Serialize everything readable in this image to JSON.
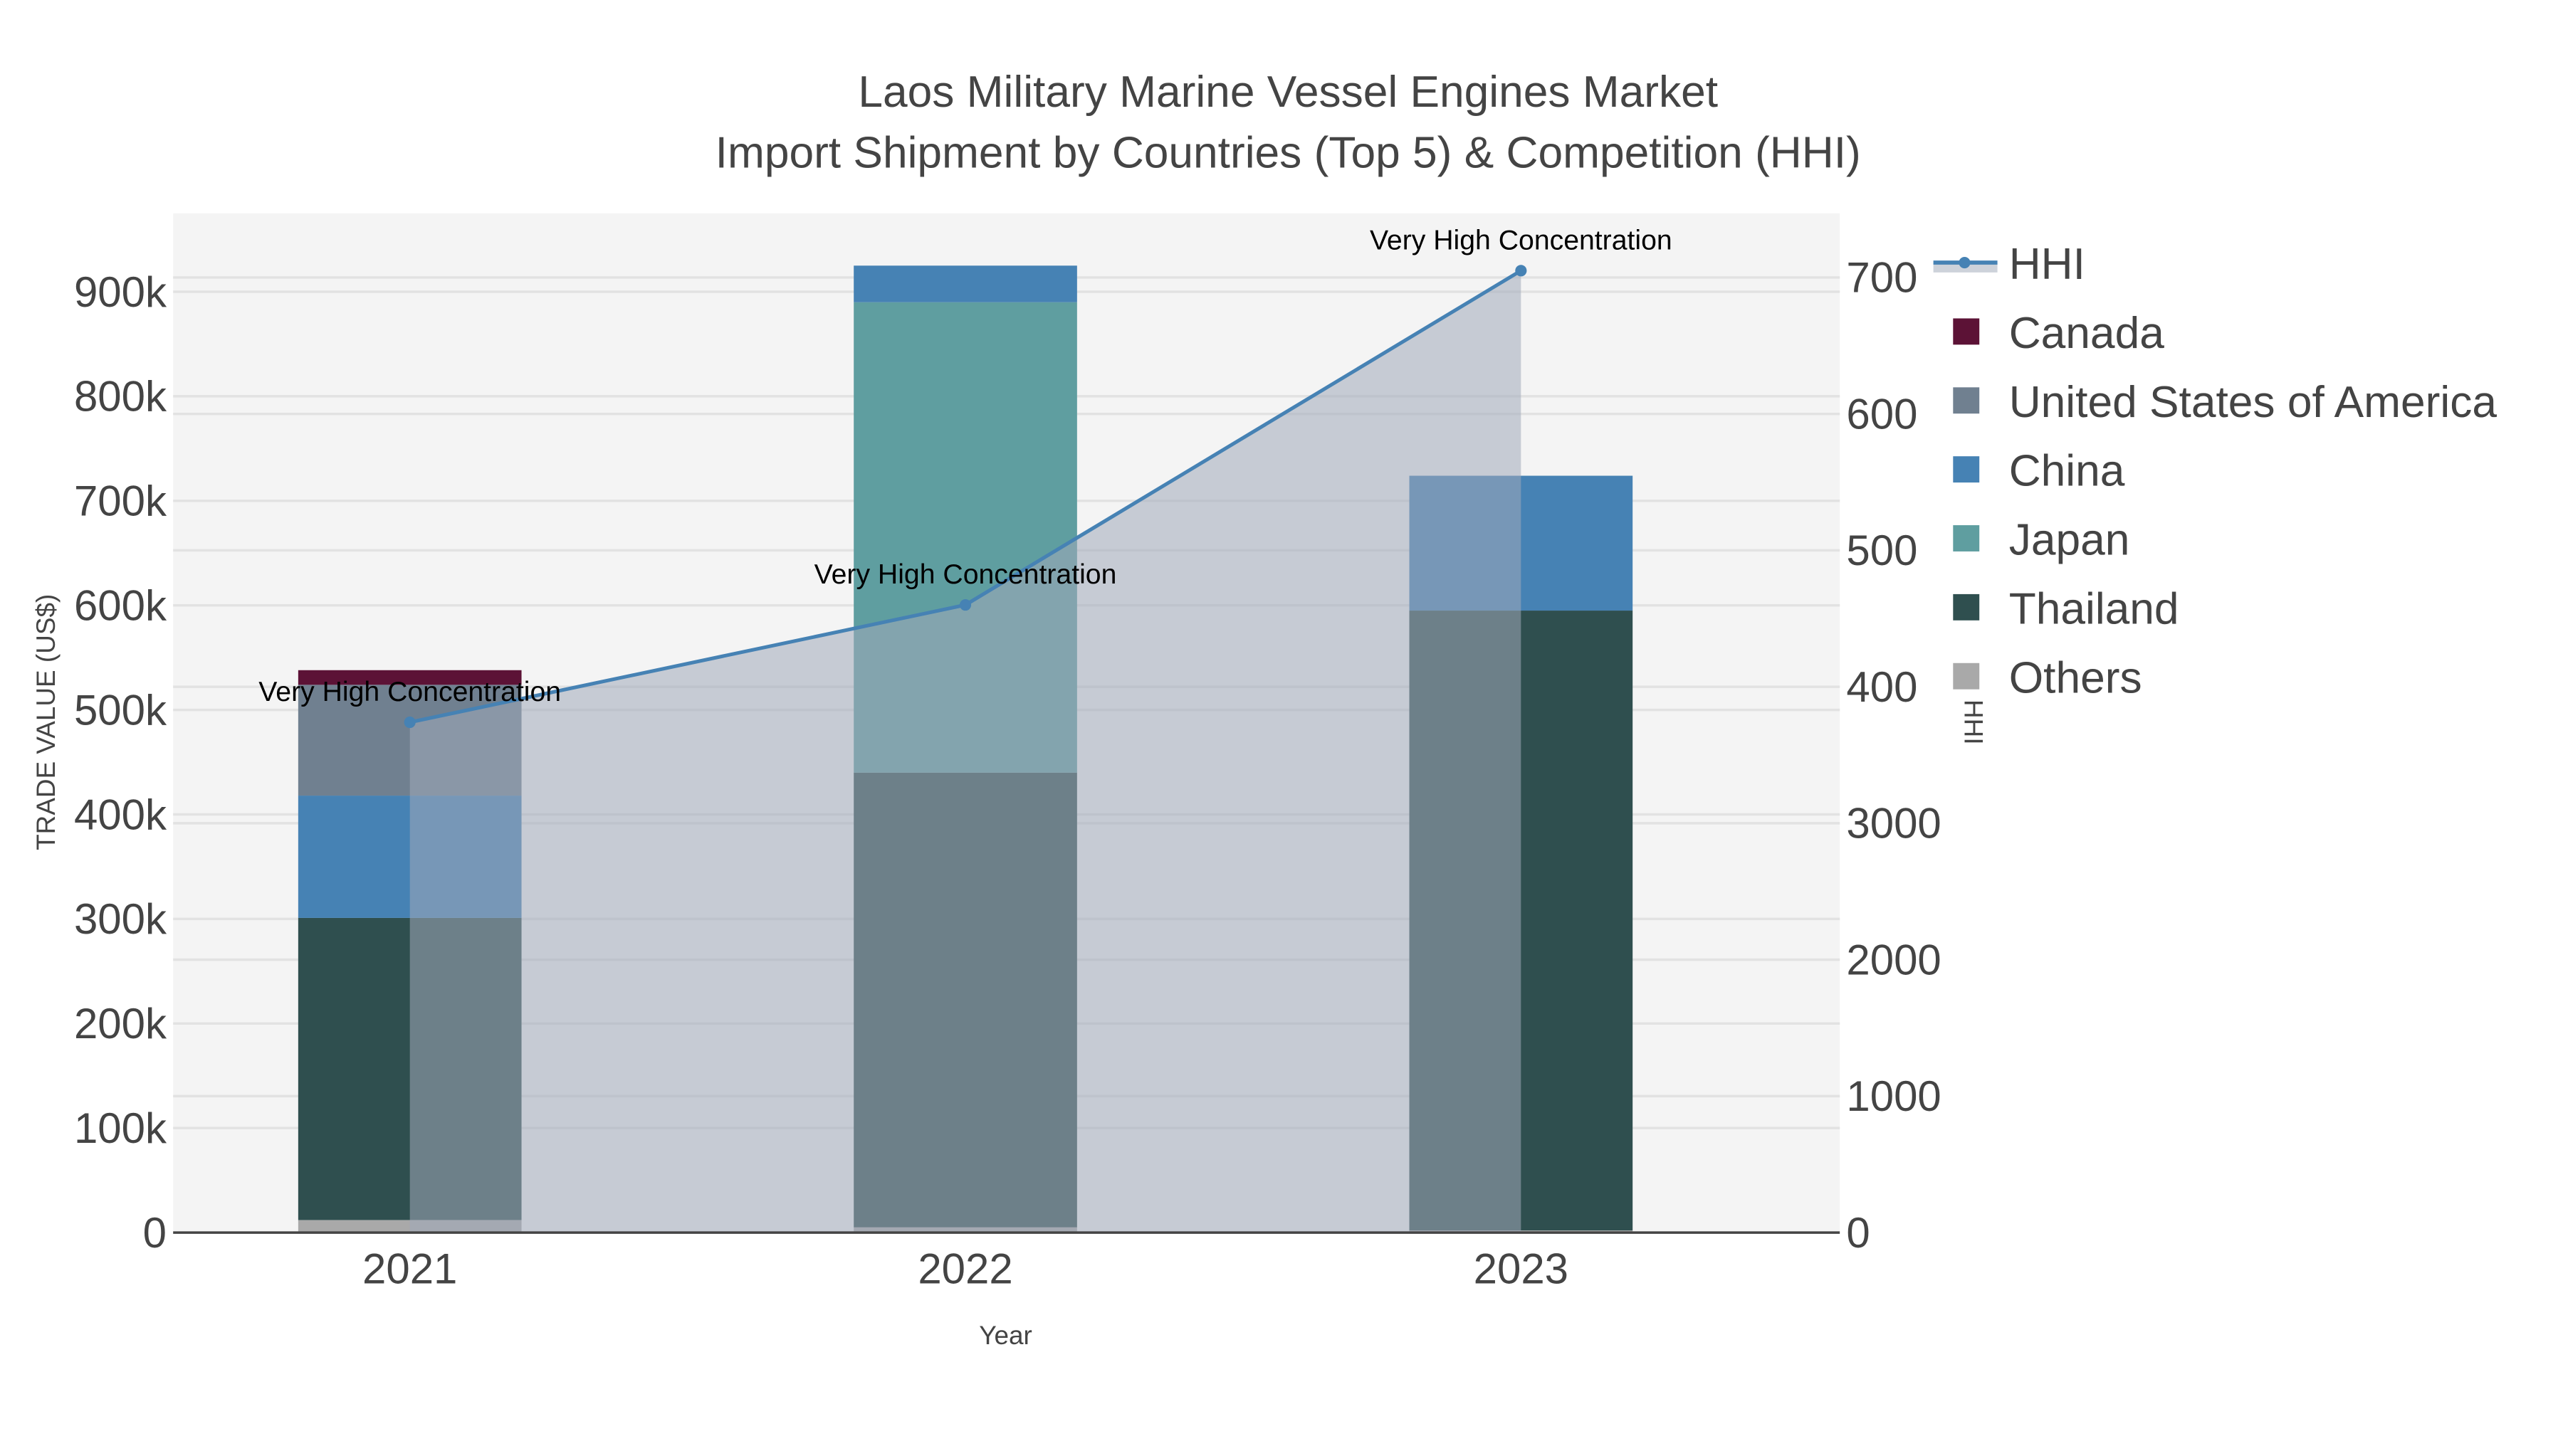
{
  "chart_data": {
    "type": "bar",
    "title": "Laos Military Marine Vessel Engines Market",
    "subtitle": "Import Shipment by Countries (Top 5) & Competition (HHI)",
    "xlabel": "Year",
    "ylabel": "TRADE VALUE (US$)",
    "y2label": "HHI",
    "categories": [
      "2021",
      "2022",
      "2023"
    ],
    "ylim": [
      0,
      975000
    ],
    "y2lim": [
      0,
      7470
    ],
    "yticks": [
      0,
      100000,
      200000,
      300000,
      400000,
      500000,
      600000,
      700000,
      800000,
      900000
    ],
    "ytick_labels": [
      "0",
      "100k",
      "200k",
      "300k",
      "400k",
      "500k",
      "600k",
      "700k",
      "800k",
      "900k"
    ],
    "y2ticks": [
      0,
      1000,
      2000,
      3000,
      4000,
      5000,
      6000,
      7000
    ],
    "y2tick_labels": [
      "0",
      "1000",
      "2000",
      "3000",
      "400",
      "500",
      "600",
      "700"
    ],
    "grid": true,
    "legend_position": "right",
    "series": [
      {
        "name": "Others",
        "color": "#a9a9a9",
        "values": [
          12000,
          5000,
          2000
        ]
      },
      {
        "name": "Thailand",
        "color": "#2f4f4f",
        "values": [
          289000,
          435000,
          593000
        ]
      },
      {
        "name": "Japan",
        "color": "#5f9ea0",
        "values": [
          0,
          450000,
          0
        ]
      },
      {
        "name": "China",
        "color": "#4682b4",
        "values": [
          117000,
          35000,
          129000
        ]
      },
      {
        "name": "United States of America",
        "color": "#708090",
        "values": [
          106000,
          0,
          0
        ]
      },
      {
        "name": "Canada",
        "color": "#5c1236",
        "values": [
          14000,
          0,
          0
        ]
      }
    ],
    "legend_order": [
      "HHI",
      "Canada",
      "United States of America",
      "China",
      "Japan",
      "Thailand",
      "Others"
    ],
    "hhi": {
      "name": "HHI",
      "color": "#4682b4",
      "fill": "rgba(160,170,185,0.55)",
      "values": [
        3740,
        4600,
        7050
      ],
      "annotations": [
        "Very High Concentration",
        "Very High Concentration",
        "Very High Concentration"
      ]
    }
  }
}
